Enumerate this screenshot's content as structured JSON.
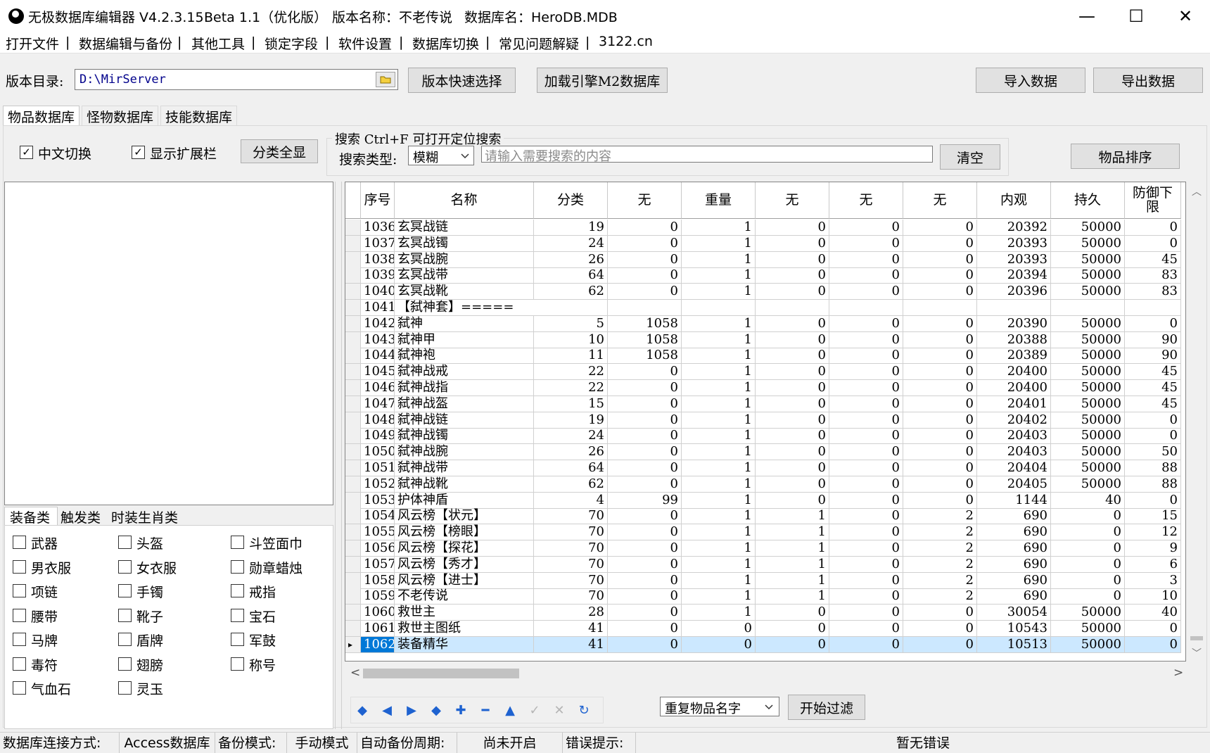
{
  "window": {
    "title": "无极数据库编辑器 V4.2.3.15",
    "beta": "Beta 1.1（优化版）",
    "version_name": "版本名称：不老传说",
    "db_name": "数据库名：HeroDB.MDB",
    "minimize": "—",
    "maximize": "☐",
    "close": "✕"
  },
  "menu": [
    "打开文件",
    "数据编辑与备份",
    "其他工具",
    "锁定字段",
    "软件设置",
    "数据库切换",
    "常见问题解疑",
    "3122.cn"
  ],
  "menu_sep": "|",
  "toolbar": {
    "dir_label": "版本目录:",
    "dir_value": "D:\\MirServer",
    "quick_select": "版本快速选择",
    "load_engine": "加载引擎M2数据库",
    "import": "导入数据",
    "export": "导出数据"
  },
  "tabs": [
    "物品数据库",
    "怪物数据库",
    "技能数据库"
  ],
  "options": {
    "chinese_switch": "中文切换",
    "show_ext": "显示扩展栏",
    "show_all": "分类全显",
    "check": "✓"
  },
  "search": {
    "legend": "搜索  Ctrl+F 可打开定位搜索",
    "type_label": "搜索类型:",
    "type_value": "模糊",
    "placeholder": "请输入需要搜索的内容",
    "clear": "清空",
    "sort": "物品排序"
  },
  "category_tabs": [
    "装备类",
    "触发类",
    "时装生肖类"
  ],
  "categories": [
    "武器",
    "头盔",
    "斗笠面巾",
    "男衣服",
    "女衣服",
    "勋章蜡烛",
    "项链",
    "手镯",
    "戒指",
    "腰带",
    "靴子",
    "宝石",
    "马牌",
    "盾牌",
    "军鼓",
    "毒符",
    "翅膀",
    "称号",
    "气血石",
    "灵玉"
  ],
  "grid": {
    "headers": [
      "序号",
      "名称",
      "分类",
      "无",
      "重量",
      "无",
      "无",
      "无",
      "内观",
      "持久",
      "防御下限"
    ],
    "rows": [
      [
        "1036",
        "玄冥战链",
        "19",
        "0",
        "1",
        "0",
        "0",
        "0",
        "20392",
        "50000",
        "0"
      ],
      [
        "1037",
        "玄冥战镯",
        "24",
        "0",
        "1",
        "0",
        "0",
        "0",
        "20393",
        "50000",
        "0"
      ],
      [
        "1038",
        "玄冥战腕",
        "26",
        "0",
        "1",
        "0",
        "0",
        "0",
        "20393",
        "50000",
        "45"
      ],
      [
        "1039",
        "玄冥战带",
        "64",
        "0",
        "1",
        "0",
        "0",
        "0",
        "20394",
        "50000",
        "83"
      ],
      [
        "1040",
        "玄冥战靴",
        "62",
        "0",
        "1",
        "0",
        "0",
        "0",
        "20396",
        "50000",
        "83"
      ],
      [
        "1041",
        "【弑神套】=====",
        "",
        "",
        "",
        "",
        "",
        "",
        "",
        "",
        ""
      ],
      [
        "1042",
        "弑神",
        "5",
        "1058",
        "1",
        "0",
        "0",
        "0",
        "20390",
        "50000",
        "0"
      ],
      [
        "1043",
        "弑神甲",
        "10",
        "1058",
        "1",
        "0",
        "0",
        "0",
        "20388",
        "50000",
        "90"
      ],
      [
        "1044",
        "弑神袍",
        "11",
        "1058",
        "1",
        "0",
        "0",
        "0",
        "20389",
        "50000",
        "90"
      ],
      [
        "1045",
        "弑神战戒",
        "22",
        "0",
        "1",
        "0",
        "0",
        "0",
        "20400",
        "50000",
        "45"
      ],
      [
        "1046",
        "弑神战指",
        "22",
        "0",
        "1",
        "0",
        "0",
        "0",
        "20400",
        "50000",
        "45"
      ],
      [
        "1047",
        "弑神战盔",
        "15",
        "0",
        "1",
        "0",
        "0",
        "0",
        "20401",
        "50000",
        "45"
      ],
      [
        "1048",
        "弑神战链",
        "19",
        "0",
        "1",
        "0",
        "0",
        "0",
        "20402",
        "50000",
        "0"
      ],
      [
        "1049",
        "弑神战镯",
        "24",
        "0",
        "1",
        "0",
        "0",
        "0",
        "20403",
        "50000",
        "0"
      ],
      [
        "1050",
        "弑神战腕",
        "26",
        "0",
        "1",
        "0",
        "0",
        "0",
        "20403",
        "50000",
        "50"
      ],
      [
        "1051",
        "弑神战带",
        "64",
        "0",
        "1",
        "0",
        "0",
        "0",
        "20404",
        "50000",
        "88"
      ],
      [
        "1052",
        "弑神战靴",
        "62",
        "0",
        "1",
        "0",
        "0",
        "0",
        "20405",
        "50000",
        "88"
      ],
      [
        "1053",
        "护体神盾",
        "4",
        "99",
        "1",
        "0",
        "0",
        "0",
        "1144",
        "40",
        "0"
      ],
      [
        "1054",
        "风云榜【状元】",
        "70",
        "0",
        "1",
        "1",
        "0",
        "2",
        "690",
        "0",
        "15"
      ],
      [
        "1055",
        "风云榜【榜眼】",
        "70",
        "0",
        "1",
        "1",
        "0",
        "2",
        "690",
        "0",
        "12"
      ],
      [
        "1056",
        "风云榜【探花】",
        "70",
        "0",
        "1",
        "1",
        "0",
        "2",
        "690",
        "0",
        "9"
      ],
      [
        "1057",
        "风云榜【秀才】",
        "70",
        "0",
        "1",
        "1",
        "0",
        "2",
        "690",
        "0",
        "6"
      ],
      [
        "1058",
        "风云榜【进士】",
        "70",
        "0",
        "1",
        "1",
        "0",
        "2",
        "690",
        "0",
        "3"
      ],
      [
        "1059",
        "不老传说",
        "70",
        "0",
        "1",
        "1",
        "0",
        "2",
        "690",
        "0",
        "10"
      ],
      [
        "1060",
        "救世主",
        "28",
        "0",
        "1",
        "0",
        "0",
        "0",
        "30054",
        "50000",
        "40"
      ],
      [
        "1061",
        "救世主图纸",
        "41",
        "0",
        "0",
        "0",
        "0",
        "0",
        "10543",
        "50000",
        "0"
      ],
      [
        "1062",
        "装备精华",
        "41",
        "0",
        "0",
        "0",
        "0",
        "0",
        "10513",
        "50000",
        "0"
      ]
    ],
    "selected_index": 26,
    "row_indicator": "▸"
  },
  "navigator": [
    "◆",
    "◀",
    "▶",
    "◆",
    "✚",
    "━",
    "▲",
    "✓",
    "✕",
    "↻"
  ],
  "filter": {
    "type_value": "重复物品名字",
    "start": "开始过滤"
  },
  "scroll": {
    "up": "︿",
    "down": "﹀",
    "left": "<",
    "right": ">"
  },
  "status": {
    "conn_label": "数据库连接方式:",
    "conn_value": "Access数据库",
    "backup_label": "备份模式:",
    "backup_value": "手动模式",
    "auto_label": "自动备份周期:",
    "auto_value": "尚未开启",
    "error_label": "错误提示:",
    "error_value": "暂无错误"
  }
}
